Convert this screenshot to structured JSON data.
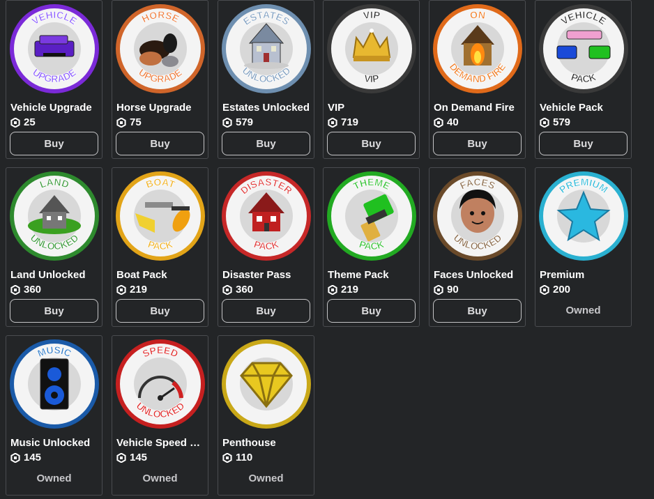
{
  "items": [
    {
      "name": "Vehicle Upgrade",
      "price": "25",
      "action": "Buy",
      "badge_top": "VEHICLE",
      "badge_bottom": "UPGRADE",
      "ring": "#7b2ad8",
      "text_color": "#8b5cff"
    },
    {
      "name": "Horse Upgrade",
      "price": "75",
      "action": "Buy",
      "badge_top": "HORSE",
      "badge_bottom": "UPGRADE",
      "ring": "#d0652a",
      "text_color": "#ee7a3a"
    },
    {
      "name": "Estates Unlocked",
      "price": "579",
      "action": "Buy",
      "badge_top": "ESTATES",
      "badge_bottom": "UNLOCKED",
      "ring": "#6e8fb0",
      "text_color": "#7e9ec0"
    },
    {
      "name": "VIP",
      "price": "719",
      "action": "Buy",
      "badge_top": "VIP",
      "badge_bottom": "VIP",
      "ring": "#3a3a3a",
      "text_color": "#2a2a2a"
    },
    {
      "name": "On Demand Fire",
      "price": "40",
      "action": "Buy",
      "badge_top": "ON",
      "badge_bottom": "DEMAND FIRE",
      "ring": "#e06a1a",
      "text_color": "#f07a20"
    },
    {
      "name": "Vehicle Pack",
      "price": "579",
      "action": "Buy",
      "badge_top": "VEHICLE",
      "badge_bottom": "PACK",
      "ring": "#3a3a3a",
      "text_color": "#2a2a2a"
    },
    {
      "name": "Land Unlocked",
      "price": "360",
      "action": "Buy",
      "badge_top": "LAND",
      "badge_bottom": "UNLOCKED",
      "ring": "#2e8a2e",
      "text_color": "#3a9a3a"
    },
    {
      "name": "Boat Pack",
      "price": "219",
      "action": "Buy",
      "badge_top": "BOAT",
      "badge_bottom": "PACK",
      "ring": "#e2a418",
      "text_color": "#f0b020"
    },
    {
      "name": "Disaster Pass",
      "price": "360",
      "action": "Buy",
      "badge_top": "DISASTER",
      "badge_bottom": "PACK",
      "ring": "#c62828",
      "text_color": "#e03a3a"
    },
    {
      "name": "Theme Pack",
      "price": "219",
      "action": "Buy",
      "badge_top": "THEME",
      "badge_bottom": "PACK",
      "ring": "#22aa22",
      "text_color": "#2fc02f"
    },
    {
      "name": "Faces Unlocked",
      "price": "90",
      "action": "Buy",
      "badge_top": "FACES",
      "badge_bottom": "UNLOCKED",
      "ring": "#6a4a2a",
      "text_color": "#8a6a4a"
    },
    {
      "name": "Premium",
      "price": "200",
      "action": "Owned",
      "badge_top": "PREMIUM",
      "badge_bottom": "",
      "ring": "#2ab0d0",
      "text_color": "#2ab8d8"
    },
    {
      "name": "Music Unlocked",
      "price": "145",
      "action": "Owned",
      "badge_top": "MUSIC",
      "badge_bottom": "",
      "ring": "#1a5aa8",
      "text_color": "#2a78c8"
    },
    {
      "name": "Vehicle Speed U...",
      "price": "145",
      "action": "Owned",
      "badge_top": "SPEED",
      "badge_bottom": "UNLOCKED",
      "ring": "#c62020",
      "text_color": "#e02a2a"
    },
    {
      "name": "Penthouse",
      "price": "110",
      "action": "Owned",
      "badge_top": "",
      "badge_bottom": "",
      "ring": "#c9a818",
      "text_color": "#d8b820"
    }
  ],
  "icons": {
    "currency": "robux-icon"
  }
}
